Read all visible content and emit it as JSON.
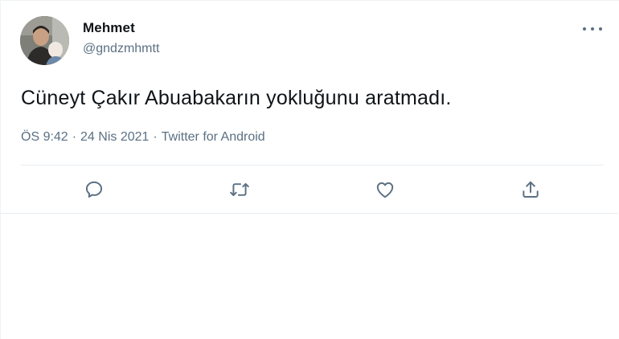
{
  "tweet": {
    "author": {
      "display_name": "Mehmet",
      "handle": "@gndzmhmtt"
    },
    "text": "Cüneyt Çakır Abuabakarın yokluğunu aratmadı.",
    "meta": {
      "time": "ÖS 9:42",
      "date": "24 Nis 2021",
      "client": "Twitter for Android",
      "separator": "·"
    },
    "actions": [
      "reply-icon",
      "retweet-icon",
      "like-icon",
      "share-icon"
    ],
    "more_icon": "more-icon"
  },
  "colors": {
    "text": "#0f1419",
    "secondary": "#5b7083",
    "divider": "#e6ecf0",
    "background": "#ffffff"
  }
}
